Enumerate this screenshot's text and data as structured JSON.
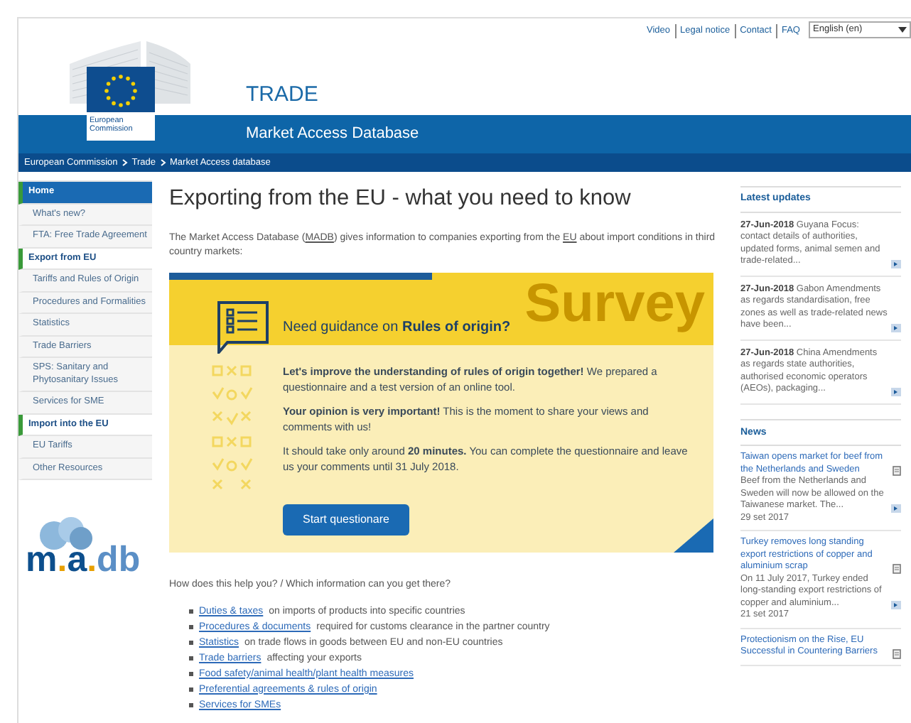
{
  "top_links": [
    "Video",
    "Legal notice",
    "Contact",
    "FAQ"
  ],
  "language": {
    "value": "English (en)"
  },
  "logo": {
    "text": "European Commission"
  },
  "site_title": "TRADE",
  "site_subtitle": "Market Access Database",
  "breadcrumb": [
    "European Commission",
    "Trade",
    "Market Access database"
  ],
  "sidebar": {
    "items": [
      {
        "kind": "item",
        "label": "Home",
        "selected": true
      },
      {
        "kind": "item",
        "label": "What's new?",
        "selected": false
      },
      {
        "kind": "item",
        "label": "FTA: Free Trade Agreement",
        "selected": false
      },
      {
        "kind": "section",
        "label": "Export from EU",
        "selected": false
      },
      {
        "kind": "item",
        "label": "Tariffs and Rules of Origin",
        "selected": false
      },
      {
        "kind": "item",
        "label": "Procedures and Formalities",
        "selected": false
      },
      {
        "kind": "item",
        "label": "Statistics",
        "selected": false
      },
      {
        "kind": "item",
        "label": "Trade Barriers",
        "selected": false
      },
      {
        "kind": "item",
        "label": "SPS: Sanitary and Phytosanitary Issues",
        "selected": false
      },
      {
        "kind": "item",
        "label": "Services for SME",
        "selected": false
      },
      {
        "kind": "section",
        "label": "Import into the EU",
        "selected": false
      },
      {
        "kind": "item",
        "label": "EU Tariffs",
        "selected": false
      },
      {
        "kind": "item",
        "label": "Other Resources",
        "selected": false
      }
    ],
    "logo_text": [
      "m",
      ".",
      "a",
      ".",
      "db"
    ]
  },
  "main": {
    "title": "Exporting from the EU - what you need to know",
    "intro": [
      "The Market Access Database (",
      "MADB",
      ") gives information to companies exporting from the ",
      "EU",
      " about import conditions in third country markets:"
    ],
    "survey": {
      "watermark": "Survey",
      "heading": "Need guidance on **Rules of origin?**",
      "paragraphs": [
        "**Let's improve the understanding of rules of origin together!** We prepared a questionnaire and a test version of an online tool.",
        "**Your opinion is very important!** This is the moment to share your views and comments with us!",
        "It should take only around **20 minutes.** You can complete the questionnaire and leave us your comments until 31 July 2018."
      ],
      "button": "Start questionare"
    },
    "question": "How does this help you? / Which information can you get there?",
    "list": [
      {
        "link": "Duties & taxes",
        "text": "on imports of products into specific countries"
      },
      {
        "link": "Procedures & documents",
        "text": "required for customs clearance in the partner country"
      },
      {
        "link": "Statistics",
        "text": "on trade flows in goods between EU and non-EU countries"
      },
      {
        "link": "Trade barriers",
        "text": "affecting your exports"
      },
      {
        "link": "Food safety/animal health/plant health measures"
      },
      {
        "link": "Preferential agreements & rules of origin"
      },
      {
        "link": "Services for SMEs"
      }
    ]
  },
  "latest_updates": {
    "title": "Latest updates",
    "items": [
      {
        "date": "27-Jun-2018",
        "text": "Guyana Focus: contact details of authorities, updated forms, animal semen and trade-related..."
      },
      {
        "date": "27-Jun-2018",
        "text": "Gabon Amendments as regards standardisation, free zones as well as trade-related news have been..."
      },
      {
        "date": "27-Jun-2018",
        "text": "China Amendments as regards state authorities, authorised economic operators (AEOs), packaging..."
      }
    ]
  },
  "news": {
    "title": "News",
    "items": [
      {
        "title": "Taiwan opens market for beef from the Netherlands and Sweden",
        "text": "Beef from the Netherlands and Sweden will now be allowed on the Taiwanese market. The...",
        "date": "29 set 2017"
      },
      {
        "title": "Turkey removes long standing export restrictions of copper and aluminium scrap",
        "text": "On 11 July 2017, Turkey ended long-standing export restrictions of copper and aluminium...",
        "date": "21 set 2017"
      },
      {
        "title": "Protectionism on the Rise, EU Successful in Countering Barriers"
      }
    ]
  }
}
